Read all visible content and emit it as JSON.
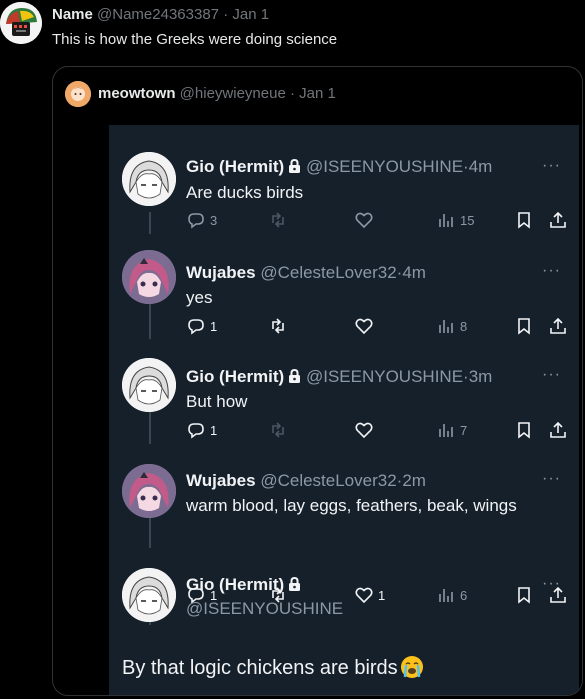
{
  "outer": {
    "name": "Name",
    "handle": "@Name24363387",
    "sep": "·",
    "date": "Jan 1",
    "text": "This is how the Greeks were doing science"
  },
  "quote": {
    "name": "meowtown",
    "handle": "@hieywieyneue",
    "sep": "·",
    "date": "Jan 1"
  },
  "posts": [
    {
      "name": "Gio (Hermit)",
      "handle": "@ISEENYOUSHINE",
      "time": "4m",
      "text": "Are ducks birds",
      "replies": "3",
      "retweets": "",
      "likes": "",
      "views": "15"
    },
    {
      "name": "Wujabes",
      "handle": "@CelesteLover32",
      "time": "4m",
      "text": "yes",
      "replies": "1",
      "retweets": "",
      "likes": "",
      "views": "8"
    },
    {
      "name": "Gio (Hermit)",
      "handle": "@ISEENYOUSHINE",
      "time": "3m",
      "text": "But how",
      "replies": "1",
      "retweets": "",
      "likes": "",
      "views": "7"
    },
    {
      "name": "Wujabes",
      "handle": "@CelesteLover32",
      "time": "2m",
      "text": "warm blood, lay eggs, feathers, beak, wings",
      "replies": "1",
      "retweets": "",
      "likes": "1",
      "views": "6"
    },
    {
      "name": "Gio (Hermit)",
      "handle": "@ISEENYOUSHINE",
      "text": "By that logic chickens are birds"
    }
  ],
  "sep": "·",
  "more": "···",
  "icons": {
    "reply": "reply-icon",
    "retweet": "retweet-icon",
    "like": "heart-icon",
    "views": "views-icon",
    "bookmark": "bookmark-icon",
    "share": "share-icon",
    "lock": "lock-icon",
    "emoji": "loudly-crying-face-emoji"
  },
  "colors": {
    "page_bg": "#000000",
    "screenshot_bg": "#16202b",
    "muted": "#71767b",
    "text": "#e7e9ea"
  }
}
